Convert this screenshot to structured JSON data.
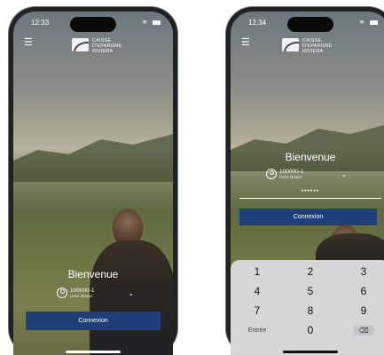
{
  "left_phone": {
    "time": "12:33",
    "bank_name_lines": [
      "CAISSE",
      "D'EPARGNE",
      "RIVIERA"
    ],
    "welcome": "Bienvenue",
    "account_number": "100000-1",
    "account_holder": "Hans Muster",
    "login_button": "Connexion"
  },
  "right_phone": {
    "time": "12:34",
    "bank_name_lines": [
      "CAISSE",
      "D'EPARGNE",
      "RIVIERA"
    ],
    "welcome": "Bienvenue",
    "account_number": "100000-1",
    "account_holder": "Hans Muster",
    "password_mask": "••••••",
    "login_button": "Connexion",
    "keypad": {
      "keys": [
        "1",
        "2",
        "3",
        "4",
        "5",
        "6",
        "7",
        "8",
        "9"
      ],
      "enter_label": "Entrée",
      "zero": "0",
      "backspace": "⌫"
    }
  },
  "colors": {
    "primary_button": "#1f3f7a",
    "keypad_bg": "#d6d6d9"
  },
  "icons": [
    "menu-icon",
    "user-icon",
    "chevron-down-icon",
    "wifi-icon",
    "battery-icon",
    "backspace-icon"
  ]
}
